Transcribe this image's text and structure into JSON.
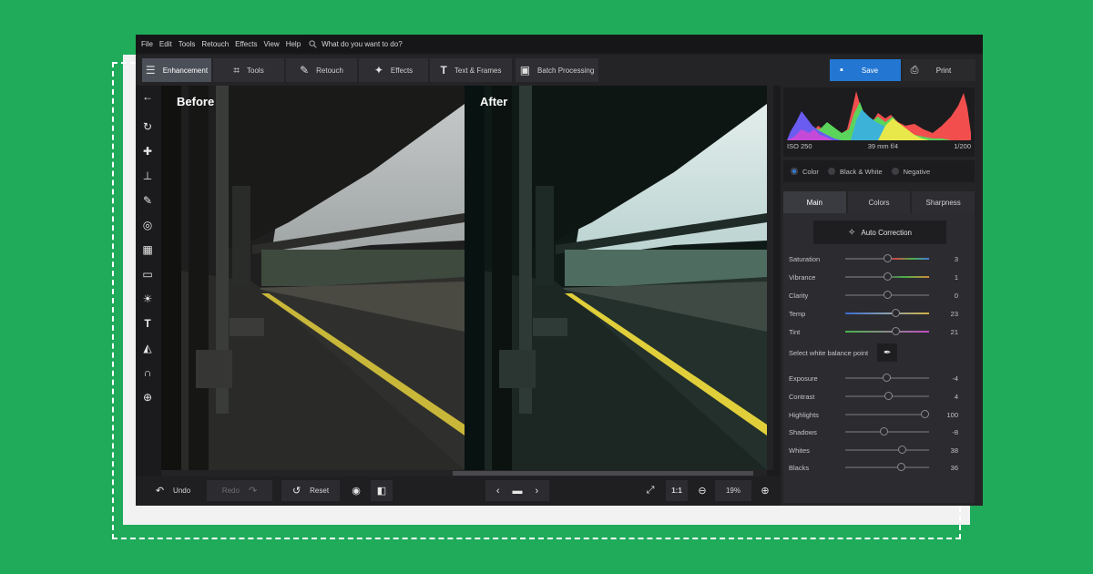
{
  "menu": [
    "File",
    "Edit",
    "Tools",
    "Retouch",
    "Effects",
    "View",
    "Help"
  ],
  "search": {
    "placeholder": "What do you want to do?"
  },
  "tabs": [
    {
      "label": "Enhancement",
      "icon": "sliders-icon",
      "active": true
    },
    {
      "label": "Tools",
      "icon": "crop-icon"
    },
    {
      "label": "Retouch",
      "icon": "brush-icon"
    },
    {
      "label": "Effects",
      "icon": "magic-wand-icon"
    },
    {
      "label": "Text & Frames",
      "icon": "text-icon"
    },
    {
      "label": "Batch Processing",
      "icon": "images-icon"
    }
  ],
  "actions": {
    "save": "Save",
    "print": "Print"
  },
  "left_tools": [
    "back-arrow-icon",
    "rotate-icon",
    "healing-icon",
    "clone-stamp-icon",
    "brush-icon",
    "radial-icon",
    "gradient-icon",
    "vignette-icon",
    "sun-icon",
    "text-icon",
    "paint-bucket-icon",
    "magnet-icon",
    "globe-icon"
  ],
  "canvas": {
    "before_label": "Before",
    "after_label": "After"
  },
  "bottom": {
    "undo": "Undo",
    "redo": "Redo",
    "reset": "Reset",
    "ratio": "1:1",
    "zoom": "19%"
  },
  "histogram": {
    "iso": "ISO 250",
    "lens": "39 mm f/4",
    "shutter": "1/200"
  },
  "color_modes": [
    {
      "label": "Color",
      "selected": true
    },
    {
      "label": "Black & White",
      "selected": false
    },
    {
      "label": "Negative",
      "selected": false
    }
  ],
  "panel_tabs": [
    {
      "label": "Main",
      "active": true
    },
    {
      "label": "Colors",
      "active": false
    },
    {
      "label": "Sharpness",
      "active": false
    }
  ],
  "auto_correction": "Auto Correction",
  "white_balance_label": "Select white balance point",
  "sliders_top": [
    {
      "name": "Saturation",
      "value": "3",
      "pos": 0.5,
      "track": "sat"
    },
    {
      "name": "Vibrance",
      "value": "1",
      "pos": 0.5,
      "track": "vib"
    },
    {
      "name": "Clarity",
      "value": "0",
      "pos": 0.5,
      "track": "plain"
    },
    {
      "name": "Temp",
      "value": "23",
      "pos": 0.6,
      "track": "temp"
    },
    {
      "name": "Tint",
      "value": "21",
      "pos": 0.6,
      "track": "tint"
    }
  ],
  "sliders_bottom": [
    {
      "name": "Exposure",
      "value": "-4",
      "pos": 0.49
    },
    {
      "name": "Contrast",
      "value": "4",
      "pos": 0.51
    },
    {
      "name": "Highlights",
      "value": "100",
      "pos": 0.95
    },
    {
      "name": "Shadows",
      "value": "-8",
      "pos": 0.46
    },
    {
      "name": "Whites",
      "value": "38",
      "pos": 0.67
    },
    {
      "name": "Blacks",
      "value": "36",
      "pos": 0.66
    }
  ],
  "colors": {
    "accent": "#2377d2",
    "background": "#1fab5a"
  }
}
